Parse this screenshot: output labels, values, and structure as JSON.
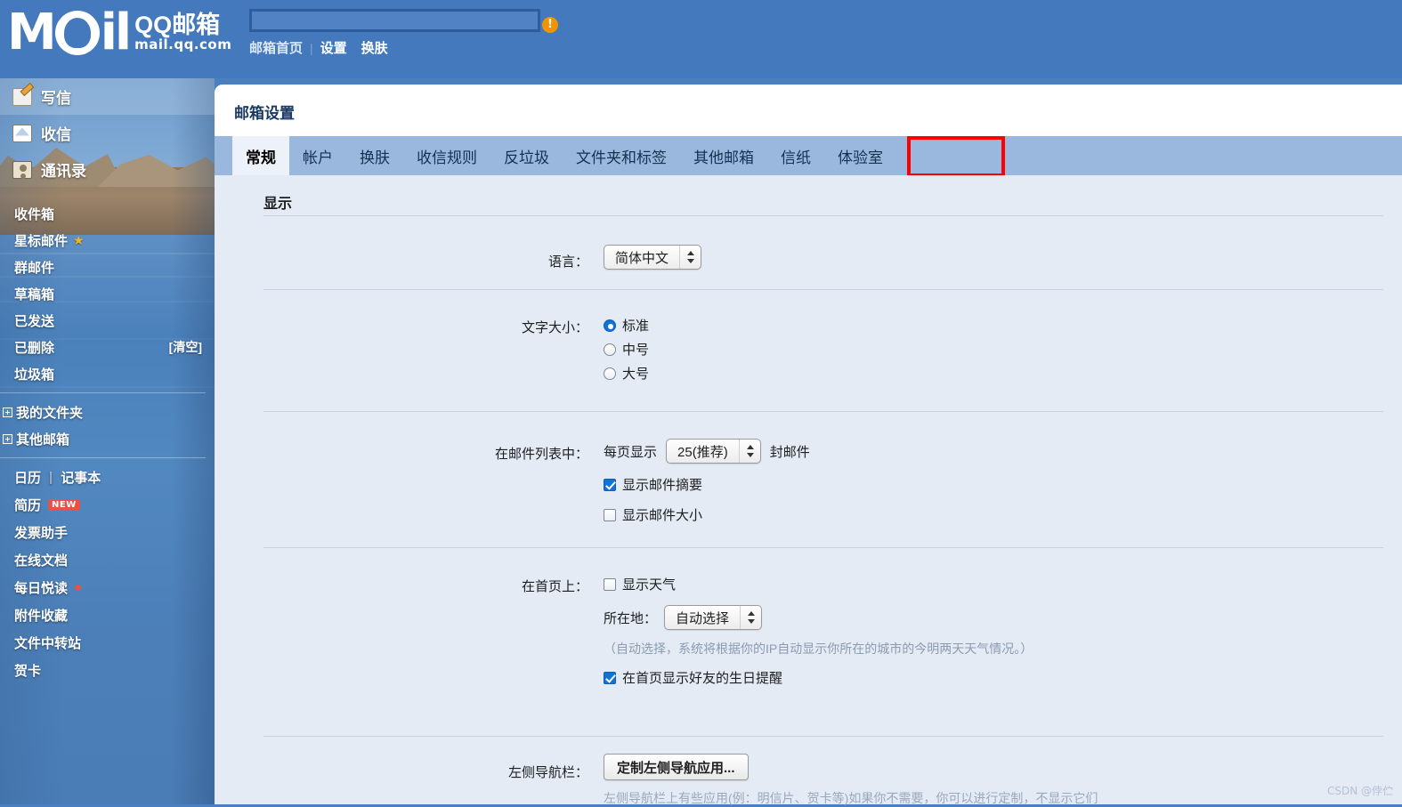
{
  "header": {
    "logo_mark": "M",
    "logo_mark_tail": "il",
    "logo_cn": "QQ邮箱",
    "logo_domain": "mail.qq.com",
    "address_value": "",
    "warning_icon": "!",
    "nav": [
      {
        "label": "邮箱首页"
      },
      {
        "label": "设置"
      },
      {
        "label": "换肤"
      }
    ],
    "nav_separator": "|"
  },
  "sidebar": {
    "main_items": [
      {
        "label": "写信",
        "icon": "compose-icon",
        "active": true
      },
      {
        "label": "收信",
        "icon": "inbox-icon",
        "active": false
      },
      {
        "label": "通讯录",
        "icon": "contacts-icon",
        "active": false
      }
    ],
    "folders": [
      {
        "label": "收件箱",
        "star": false,
        "action": ""
      },
      {
        "label": "星标邮件",
        "star": true,
        "action": ""
      },
      {
        "label": "群邮件",
        "star": false,
        "action": ""
      },
      {
        "label": "草稿箱",
        "star": false,
        "action": ""
      },
      {
        "label": "已发送",
        "star": false,
        "action": ""
      },
      {
        "label": "已删除",
        "star": false,
        "action": "[清空]"
      },
      {
        "label": "垃圾箱",
        "star": false,
        "action": ""
      }
    ],
    "star_glyph": "★",
    "expandables": [
      {
        "label": "我的文件夹"
      },
      {
        "label": "其他邮箱"
      }
    ],
    "apps": [
      {
        "label": "日历",
        "sep": "|",
        "label2": "记事本",
        "badge": "",
        "dot": false
      },
      {
        "label": "简历",
        "badge": "NEW",
        "dot": false
      },
      {
        "label": "发票助手",
        "badge": "",
        "dot": false
      },
      {
        "label": "在线文档",
        "badge": "",
        "dot": false
      },
      {
        "label": "每日悦读",
        "badge": "",
        "dot": true
      },
      {
        "label": "附件收藏",
        "badge": "",
        "dot": false
      },
      {
        "label": "文件中转站",
        "badge": "",
        "dot": false
      },
      {
        "label": "贺卡",
        "badge": "",
        "dot": false
      }
    ]
  },
  "panel": {
    "title": "邮箱设置",
    "tabs": [
      {
        "label": "常规",
        "active": true
      },
      {
        "label": "帐户",
        "active": false
      },
      {
        "label": "换肤",
        "active": false
      },
      {
        "label": "收信规则",
        "active": false
      },
      {
        "label": "反垃圾",
        "active": false
      },
      {
        "label": "文件夹和标签",
        "active": false
      },
      {
        "label": "其他邮箱",
        "active": false,
        "highlighted": true
      },
      {
        "label": "信纸",
        "active": false
      },
      {
        "label": "体验室",
        "active": false
      }
    ],
    "highlight_color": "#ff0000"
  },
  "settings": {
    "section_title": "显示",
    "language": {
      "label": "语言：",
      "value": "简体中文"
    },
    "font_size": {
      "label": "文字大小：",
      "options": [
        {
          "label": "标准",
          "selected": true
        },
        {
          "label": "中号",
          "selected": false
        },
        {
          "label": "大号",
          "selected": false
        }
      ]
    },
    "mail_list": {
      "label": "在邮件列表中：",
      "per_page_prefix": "每页显示",
      "per_page_value": "25(推荐)",
      "per_page_suffix": "封邮件",
      "checkboxes": [
        {
          "label": "显示邮件摘要",
          "checked": true
        },
        {
          "label": "显示邮件大小",
          "checked": false
        }
      ]
    },
    "homepage": {
      "label": "在首页上：",
      "show_weather": {
        "label": "显示天气",
        "checked": false
      },
      "location_label": "所在地：",
      "location_value": "自动选择",
      "location_hint": "（自动选择，系统将根据你的IP自动显示你所在的城市的今明两天天气情况。）",
      "birthday": {
        "label": "在首页显示好友的生日提醒",
        "checked": true
      }
    },
    "left_nav": {
      "label": "左侧导航栏：",
      "button": "定制左侧导航应用...",
      "hint": "左侧导航栏上有些应用(例：明信片、贺卡等)如果你不需要，你可以进行定制，不显示它们"
    }
  },
  "watermark": "CSDN @侼伫"
}
